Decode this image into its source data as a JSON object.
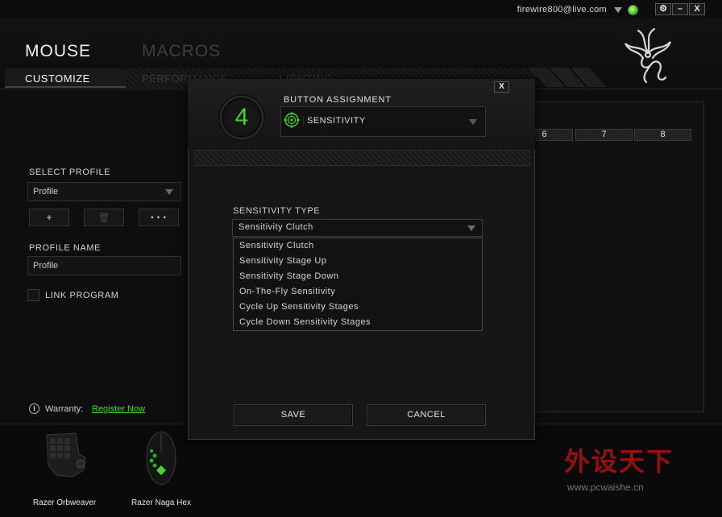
{
  "account": {
    "email": "firewire800@live.com"
  },
  "window_controls": {
    "settings": "⚙",
    "minimize": "–",
    "close": "X"
  },
  "main_tabs": [
    {
      "label": "MOUSE"
    },
    {
      "label": "MACROS"
    }
  ],
  "sub_tabs": [
    {
      "label": "CUSTOMIZE"
    },
    {
      "label": "PERFORMANCE"
    },
    {
      "label": "LIGHTING"
    }
  ],
  "profile": {
    "select_label": "SELECT PROFILE",
    "selected": "Profile",
    "add_label": "+",
    "delete_label": "🗑",
    "more_label": "• • •",
    "name_label": "PROFILE NAME",
    "name_value": "Profile",
    "link_program_label": "LINK PROGRAM"
  },
  "warranty": {
    "label": "Warranty:",
    "link": "Register Now"
  },
  "grid_headers": [
    "6",
    "7",
    "8"
  ],
  "devices": [
    {
      "name": "Razer Orbweaver"
    },
    {
      "name": "Razer Naga Hex"
    }
  ],
  "dialog": {
    "close_label": "X",
    "button_number": "4",
    "title": "BUTTON ASSIGNMENT",
    "assignment_value": "SENSITIVITY",
    "sensitivity_type_label": "SENSITIVITY TYPE",
    "sensitivity_type_value": "Sensitivity Clutch",
    "options": [
      "Sensitivity Clutch",
      "Sensitivity Stage Up",
      "Sensitivity Stage Down",
      "On-The-Fly Sensitivity",
      "Cycle Up Sensitivity Stages",
      "Cycle Down Sensitivity Stages"
    ],
    "save_label": "SAVE",
    "cancel_label": "CANCEL"
  },
  "colors": {
    "accent": "#44d62c",
    "background": "#0b0b0b",
    "text": "#cfcfcf"
  },
  "watermark": {
    "text": "外设天下",
    "url": "www.pcwaishe.cn"
  }
}
